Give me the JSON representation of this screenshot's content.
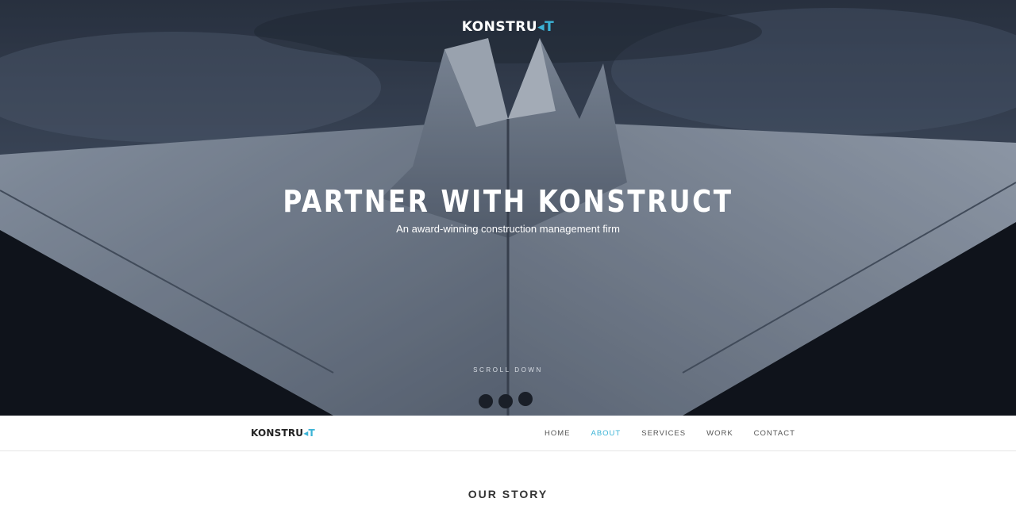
{
  "hero": {
    "logo_main": "KONSTRU",
    "logo_accent": "◂T",
    "title": "PARTNER WITH KONSTRUCT",
    "subtitle": "An award-winning construction management firm",
    "scroll_label": "SCROLL DOWN"
  },
  "nav": {
    "logo_main": "KONSTRU",
    "logo_accent": "◂T",
    "items": [
      {
        "label": "HOME"
      },
      {
        "label": "ABOUT"
      },
      {
        "label": "SERVICES"
      },
      {
        "label": "WORK"
      },
      {
        "label": "CONTACT"
      }
    ]
  },
  "sections": {
    "story_title": "OUR STORY"
  },
  "colors": {
    "accent": "#3bb3d6",
    "nav_text": "#555555",
    "heading": "#333333"
  }
}
